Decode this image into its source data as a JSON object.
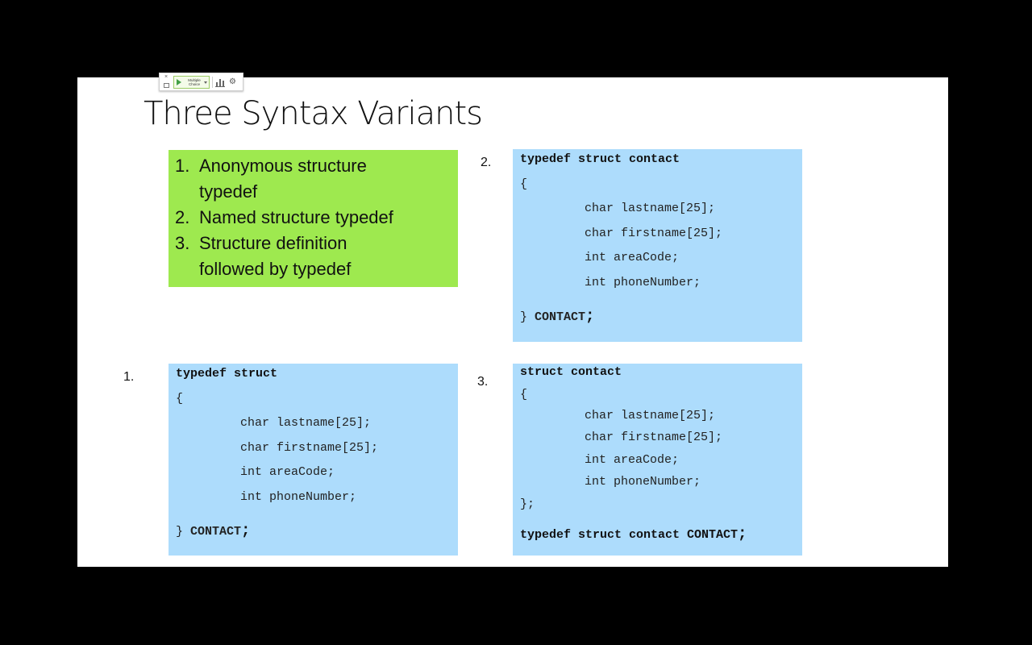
{
  "slide": {
    "title": "Three Syntax Variants"
  },
  "poll_toolbar": {
    "close_glyph": "×",
    "launch_label": "Multiple Choice",
    "settings_glyph": "⚙"
  },
  "summary": {
    "items": [
      {
        "num": "1.",
        "line1": "Anonymous structure",
        "line2": "typedef"
      },
      {
        "num": "2.",
        "line1": "Named structure typedef"
      },
      {
        "num": "3.",
        "line1": "Structure definition",
        "line2": "followed by typedef"
      }
    ]
  },
  "variants": {
    "v1": {
      "number": "1.",
      "header": "typedef struct",
      "open_brace": "{",
      "fields": [
        "char lastname[25];",
        "char firstname[25];",
        "int areaCode;",
        "int phoneNumber;"
      ],
      "close_brace": "}",
      "type_name": "CONTACT",
      "semicolon": ";"
    },
    "v2": {
      "number": "2.",
      "header": "typedef struct contact",
      "open_brace": "{",
      "fields": [
        "char lastname[25];",
        "char firstname[25];",
        "int areaCode;",
        "int phoneNumber;"
      ],
      "close_brace": "}",
      "type_name": "CONTACT",
      "semicolon": ";"
    },
    "v3": {
      "number": "3.",
      "header": "struct contact",
      "open_brace": "{",
      "fields": [
        "char lastname[25];",
        "char firstname[25];",
        "int areaCode;",
        "int phoneNumber;"
      ],
      "close_brace": "};",
      "typedef_line": "typedef struct contact CONTACT",
      "semicolon": ";"
    }
  },
  "colors": {
    "summary_bg": "#9ee94f",
    "code_bg": "#addcfc",
    "slide_bg": "#ffffff",
    "frame_bg": "#000000"
  }
}
